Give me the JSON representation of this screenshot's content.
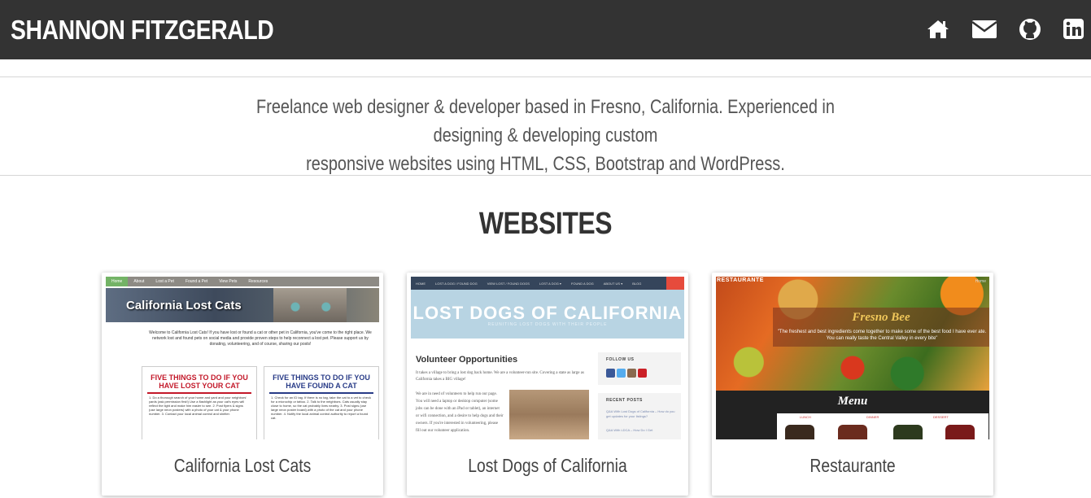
{
  "header": {
    "brand": "SHANNON FITZGERALD",
    "icons": [
      "home-icon",
      "envelope-icon",
      "github-icon",
      "linkedin-icon"
    ]
  },
  "intro": {
    "line1": "Freelance web designer & developer based in Fresno, California. Experienced in designing & developing custom",
    "line2": "responsive websites using HTML, CSS, Bootstrap and WordPress."
  },
  "section": {
    "title": "WEBSITES"
  },
  "cards": [
    {
      "title": "California Lost Cats",
      "thumb": {
        "menu": [
          "Home",
          "About",
          "Lost a Pet",
          "Found a Pet",
          "View Pets",
          "Resources"
        ],
        "banner": "California Lost Cats",
        "welcome": "Welcome to California Lost Cats! If you have lost or found a cat or other pet in California, you've come to the right place. We network lost and found pets on social media and provide proven steps to help reconnect a lost pet. Please support us by donating, volunteering, and of course, sharing our posts!",
        "box1_title": "FIVE THINGS TO DO IF YOU HAVE LOST YOUR CAT",
        "box1_text": "1. Do a thorough search of your home and yard and your neighbors' yards (ask permission first!) Use a flashlight as your cat's eyes will reflect the light and make him easier to see. 2. Post flyers & signs (use large neon posters) with a photo of your cat & your phone number. 3. Contact your local animal control and shelter.",
        "box2_title": "FIVE THINGS TO DO IF YOU HAVE FOUND A CAT",
        "box2_text": "1. Check for an ID tag. If there is no tag, take the cat to a vet to check for a microchip or tattoo. 2. Talk to the neighbors. Cats usually stay close to home, so the cat probably lives nearby. 3. Post signs (use large neon poster board) with a photo of the cat and your phone number. 4. Notify the local animal control authority to report a found cat."
      }
    },
    {
      "title": "Lost Dogs of California",
      "thumb": {
        "menu": [
          "HOME",
          "LOST A DOG / FOUND DOG",
          "VIEW LOST / FOUND DOGS",
          "LOST A DOG ▾",
          "FOUND A DOG",
          "ABOUT US ▾",
          "BLOG"
        ],
        "banner": "LOST DOGS OF CALIFORNIA",
        "subbanner": "REUNITING LOST DOGS WITH THEIR PEOPLE",
        "heading": "Volunteer Opportunities",
        "text1": "It takes a village to bring a lost dog back home. We are a volunteer-run site. Covering a state as large as California takes a BIG village!",
        "text2": "We are in need of volunteers to help run our page. You will need a laptop or desktop computer (some jobs can be done with an iPad or tablet), an internet or wifi connection, and a desire to help dogs and their owners. If you're interested in volunteering, please fill out our volunteer application.",
        "follow": "FOLLOW US",
        "recent": "RECENT POSTS",
        "post1": "Q&A With Lost Dogs of California – How do you get updates for your listings?",
        "post2": "Q&A With LDCA – How Do I Get"
      }
    },
    {
      "title": "Restaurante",
      "thumb": {
        "brand": "RESTAURANTE",
        "home": "Home",
        "tagline": "Fresno Bee",
        "quote": "\"The freshest and best ingredients come together to make some of the best food I have ever ate. You can really taste the Central Valley in every bite\"",
        "menu": "Menu",
        "tabs": [
          "LUNCH",
          "DINNER",
          "DESSERT"
        ]
      }
    }
  ]
}
